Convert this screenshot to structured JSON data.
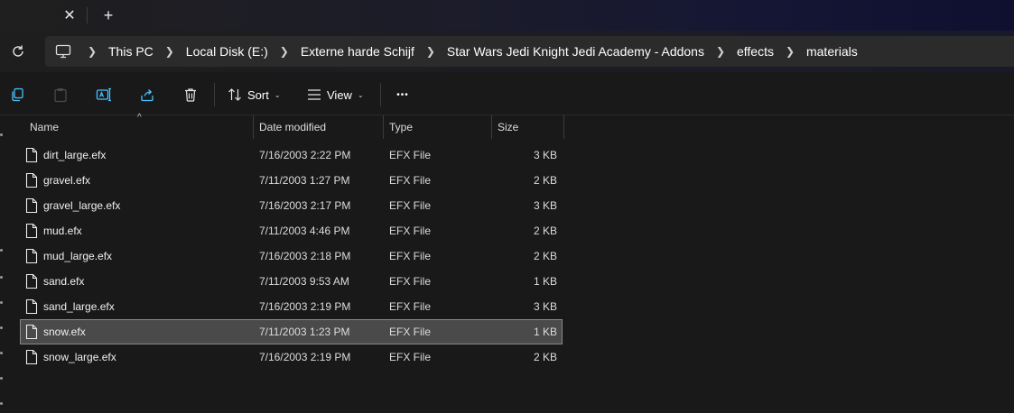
{
  "tabs": {
    "close_glyph": "✕",
    "new_glyph": "+"
  },
  "breadcrumb": [
    {
      "label": "This PC"
    },
    {
      "label": "Local Disk (E:)"
    },
    {
      "label": "Externe harde Schijf"
    },
    {
      "label": "Star Wars Jedi Knight Jedi Academy - Addons"
    },
    {
      "label": "effects"
    },
    {
      "label": "materials"
    }
  ],
  "toolbar": {
    "sort_label": "Sort",
    "view_label": "View",
    "more_label": "•••"
  },
  "columns": {
    "name": "Name",
    "date": "Date modified",
    "type": "Type",
    "size": "Size"
  },
  "files": [
    {
      "name": "dirt_large.efx",
      "date": "7/16/2003 2:22 PM",
      "type": "EFX File",
      "size": "3 KB"
    },
    {
      "name": "gravel.efx",
      "date": "7/11/2003 1:27 PM",
      "type": "EFX File",
      "size": "2 KB"
    },
    {
      "name": "gravel_large.efx",
      "date": "7/16/2003 2:17 PM",
      "type": "EFX File",
      "size": "3 KB"
    },
    {
      "name": "mud.efx",
      "date": "7/11/2003 4:46 PM",
      "type": "EFX File",
      "size": "2 KB"
    },
    {
      "name": "mud_large.efx",
      "date": "7/16/2003 2:18 PM",
      "type": "EFX File",
      "size": "2 KB"
    },
    {
      "name": "sand.efx",
      "date": "7/11/2003 9:53 AM",
      "type": "EFX File",
      "size": "1 KB"
    },
    {
      "name": "sand_large.efx",
      "date": "7/16/2003 2:19 PM",
      "type": "EFX File",
      "size": "3 KB"
    },
    {
      "name": "snow.efx",
      "date": "7/11/2003 1:23 PM",
      "type": "EFX File",
      "size": "1 KB",
      "selected": true
    },
    {
      "name": "snow_large.efx",
      "date": "7/16/2003 2:19 PM",
      "type": "EFX File",
      "size": "2 KB"
    }
  ],
  "colors": {
    "background": "#191919",
    "address_bar": "#2b2b2b",
    "accent_icon": "#4cc2ff",
    "selected_row": "#4a4a4a"
  }
}
